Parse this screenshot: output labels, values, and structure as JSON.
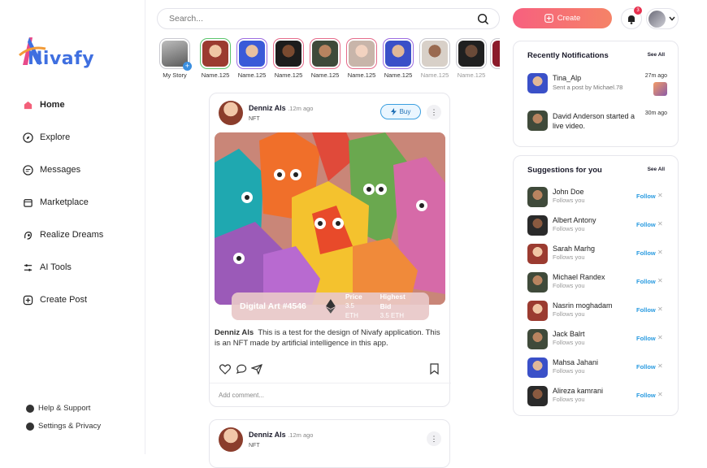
{
  "app": {
    "logo_text": "Nivafy"
  },
  "sidebar": {
    "items": [
      {
        "label": "Home",
        "icon": "home-icon"
      },
      {
        "label": "Explore",
        "icon": "compass-icon"
      },
      {
        "label": "Messages",
        "icon": "chat-icon"
      },
      {
        "label": "Marketplace",
        "icon": "store-icon"
      },
      {
        "label": "Realize Dreams",
        "icon": "dream-icon"
      },
      {
        "label": "AI Tools",
        "icon": "sliders-icon"
      },
      {
        "label": "Create Post",
        "icon": "plus-square-icon"
      }
    ],
    "footer": [
      {
        "label": "Help & Support",
        "icon": "help-icon"
      },
      {
        "label": "Settings & Privacy",
        "icon": "settings-icon"
      }
    ]
  },
  "header": {
    "search_placeholder": "Search...",
    "create_label": "Create",
    "notification_count": "3"
  },
  "stories": [
    {
      "label": "My Story"
    },
    {
      "label": "Name.125"
    },
    {
      "label": "Name.125"
    },
    {
      "label": "Name.125"
    },
    {
      "label": "Name.125"
    },
    {
      "label": "Name.125"
    },
    {
      "label": "Name.125"
    },
    {
      "label": "Name.125"
    },
    {
      "label": "Name.125"
    }
  ],
  "post": {
    "author": "Denniz Als",
    "time": ".12m ago",
    "tag": "NFT",
    "buy_label": "Buy",
    "art_title": "Digital Art #4546",
    "price_label": "Price",
    "price_value": "3.5 ETH",
    "bid_label": "Highest Bid",
    "bid_value": "3.5 ETH",
    "caption_author": "Denniz Als",
    "caption_text": "This is a test for the design of Nivafy application. This is an NFT made by artificial intelligence in this app.",
    "comment_placeholder": "Add comment..."
  },
  "post2": {
    "author": "Denniz Als",
    "time": ".12m ago",
    "tag": "NFT"
  },
  "notifications": {
    "title": "Recently  Notifications",
    "see_all": "See All",
    "items": [
      {
        "line1": "Tina_Alp",
        "line2": "Sent a post by Michael.78",
        "time": "27m ago"
      },
      {
        "line1": "David Anderson started a live video.",
        "line2": "",
        "time": "30m ago"
      }
    ]
  },
  "suggestions": {
    "title": "Suggestions for you",
    "see_all": "See All",
    "follow_label": "Follow",
    "sub": "Follows you",
    "people": [
      "John Doe",
      "Albert Antony",
      "Sarah Marhg",
      "Michael Randex",
      "Nasrin moghadam",
      "Jack Balrt",
      "Mahsa Jahani",
      "Alireza kamrani"
    ]
  }
}
